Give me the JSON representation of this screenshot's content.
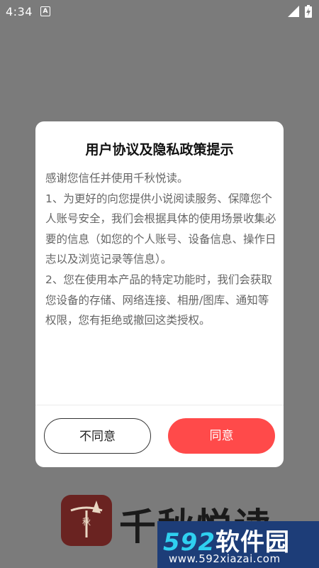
{
  "status_bar": {
    "time": "4:34",
    "notification_glyph": "A",
    "icons": [
      "signal-icon",
      "battery-icon"
    ]
  },
  "dialog": {
    "title": "用户协议及隐私政策提示",
    "paragraphs": [
      "感谢您信任并使用千秋悦读。",
      "1、为更好的向您提供小说阅读服务、保障您个人账号安全，我们会根据具体的使用场景收集必要的信息（如您的个人账号、设备信息、操作日志以及浏览记录等信息）。",
      "2、您在使用本产品的特定功能时，我们会获取您设备的存储、网络连接、相册/图库、通知等权限，您有拒绝或撤回这类授权。"
    ],
    "disagree_label": "不同意",
    "agree_label": "同意"
  },
  "app": {
    "logo_glyph": "秋",
    "name": "千秋悦读"
  },
  "watermark": {
    "number": "592",
    "name": "软件园",
    "url": "www.592xiazai.com"
  },
  "colors": {
    "overlay": "#7b7b7b",
    "accent": "#ff4a4a",
    "watermark_bg": "#1d3d78"
  }
}
